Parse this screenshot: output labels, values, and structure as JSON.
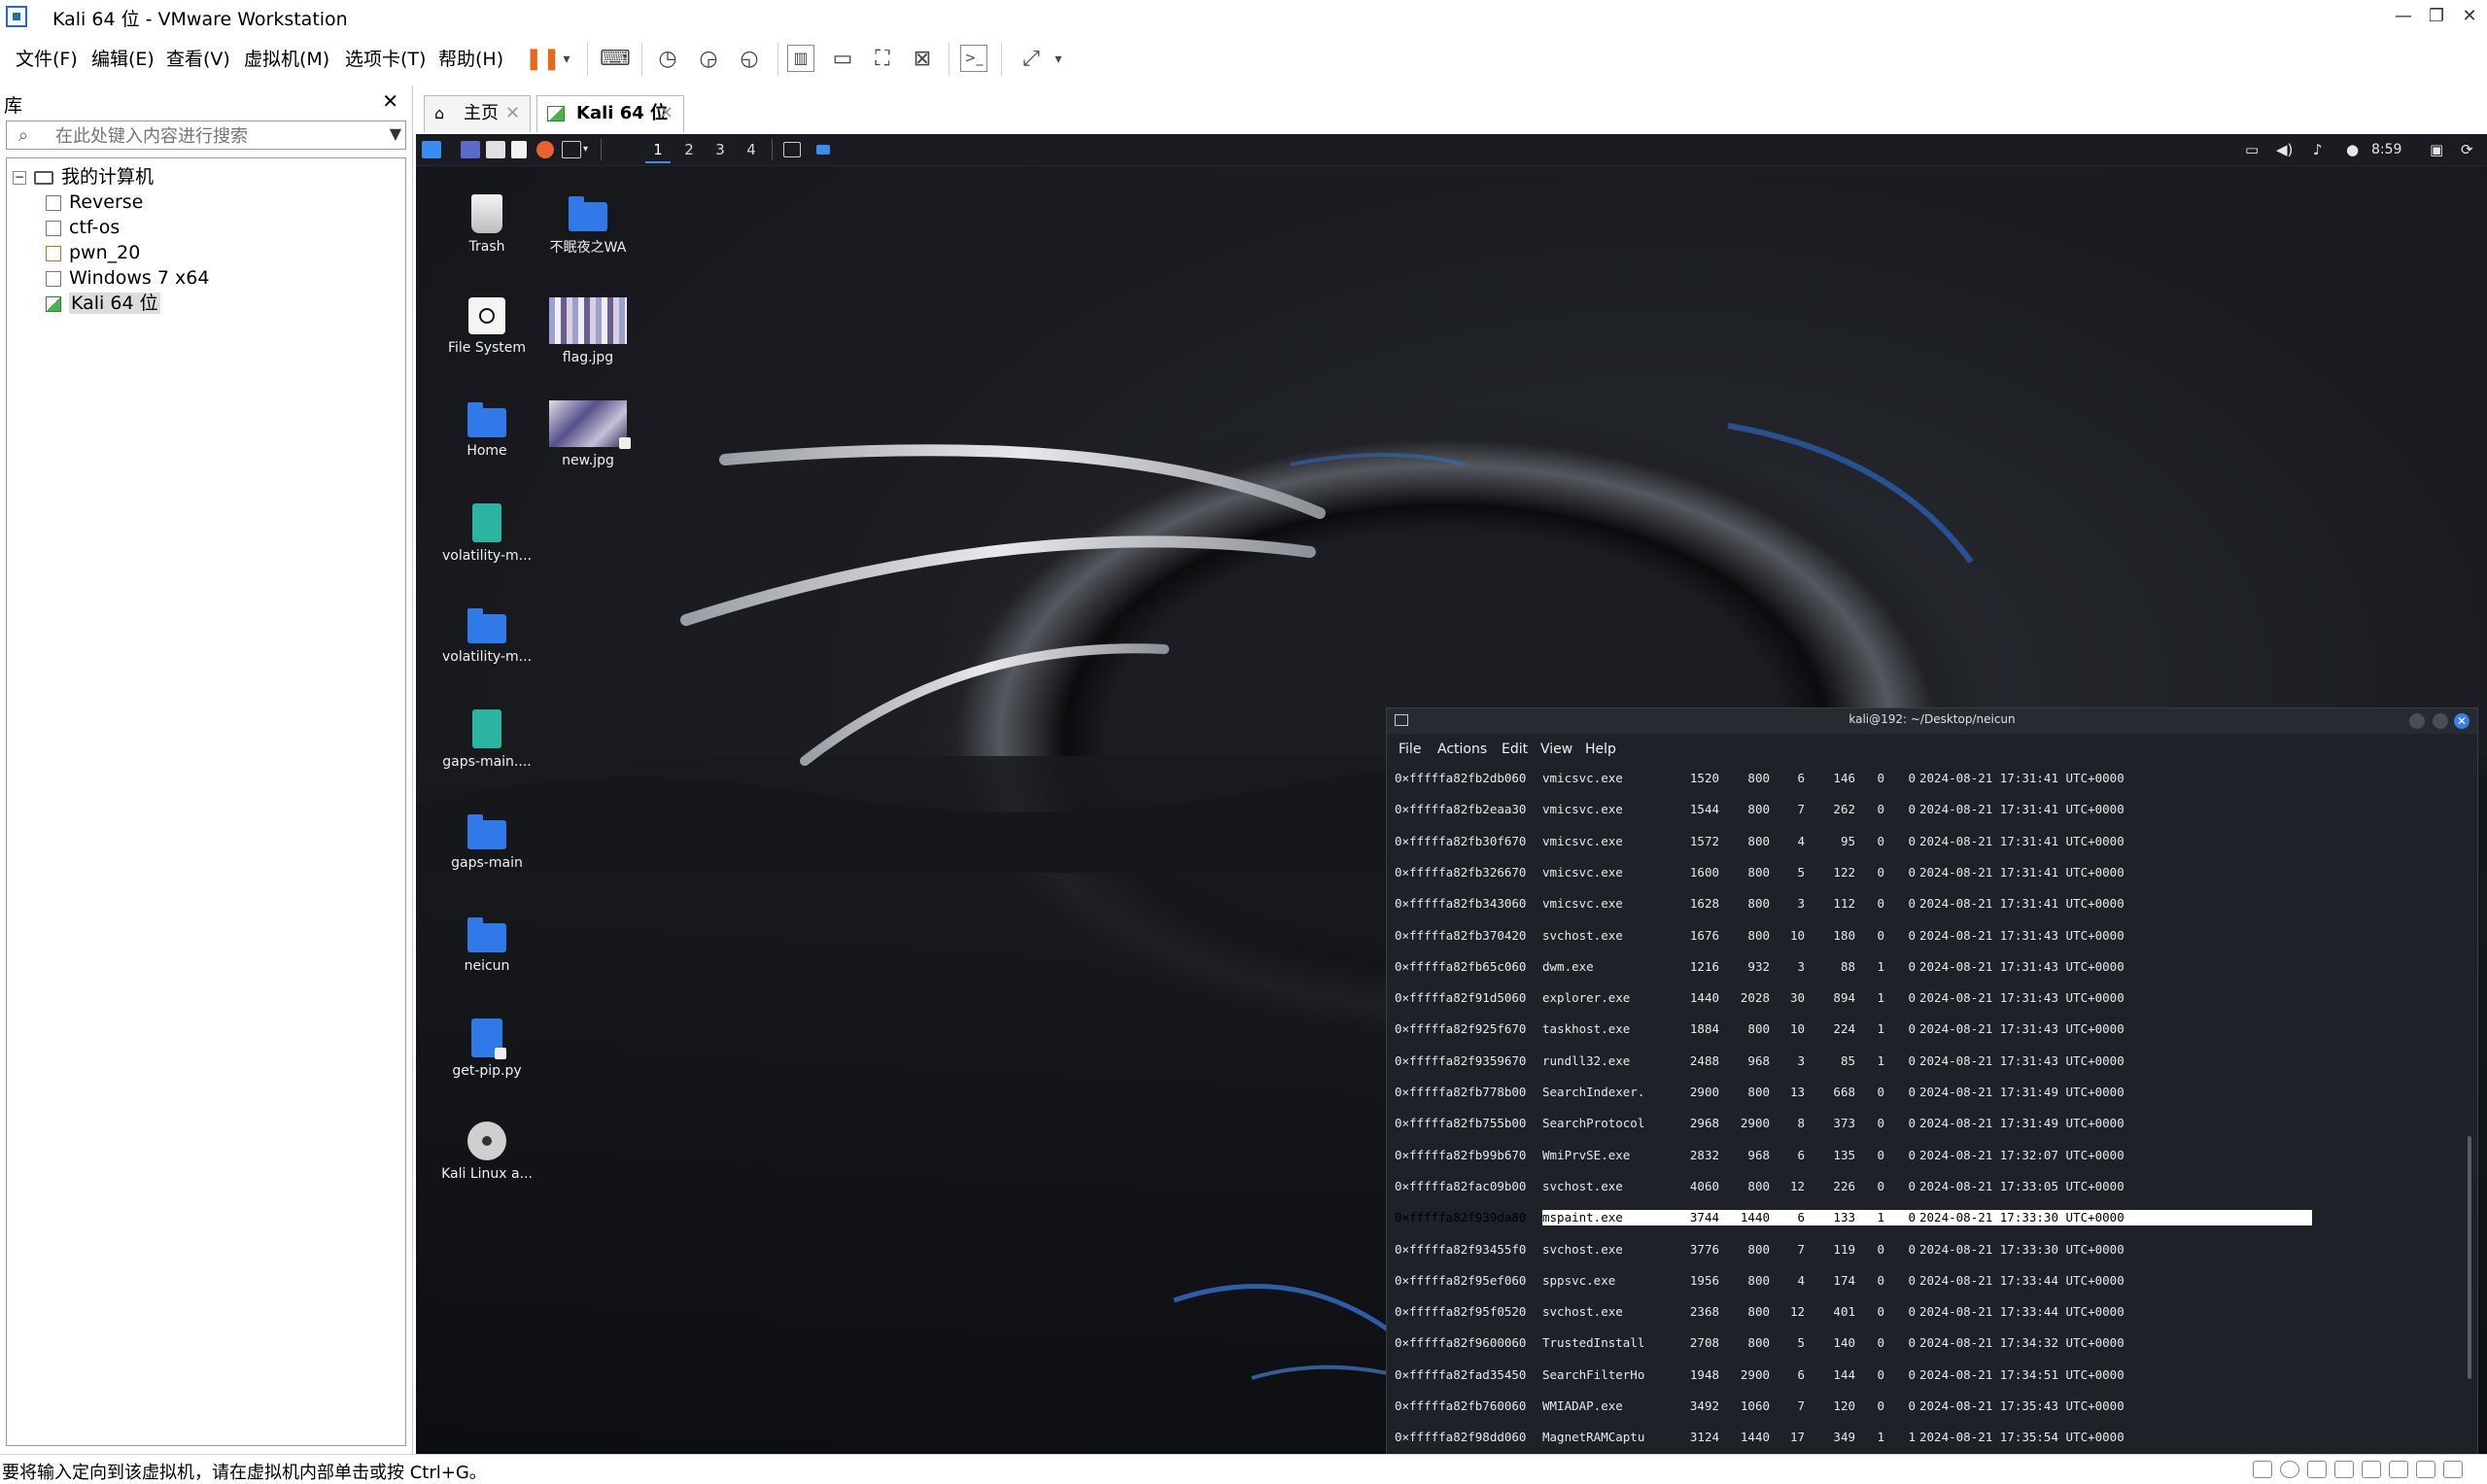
{
  "window": {
    "title": "Kali 64 位 - VMware Workstation",
    "app_icon": "vmware-icon",
    "controls": [
      "minimize",
      "restore",
      "close"
    ]
  },
  "menu": [
    "文件(F)",
    "编辑(E)",
    "查看(V)",
    "虚拟机(M)",
    "选项卡(T)",
    "帮助(H)"
  ],
  "toolbar": {
    "accent": "#e8681a",
    "icons": [
      "pause-icon",
      "dropdown-icon",
      "send-keys-icon",
      "snapshot-icon",
      "revert-snapshot-icon",
      "snapshot-manager-icon",
      "library-view-icon",
      "thumbnail-view-icon",
      "fullscreen-icon",
      "unity-icon",
      "console-icon",
      "stretch-icon",
      "dropdown-icon"
    ]
  },
  "library": {
    "title": "库",
    "search_placeholder": "在此处键入内容进行搜索",
    "root": "我的计算机",
    "items": [
      {
        "label": "Reverse",
        "icon": "vm-icon"
      },
      {
        "label": "ctf-os",
        "icon": "vm-icon"
      },
      {
        "label": "pwn_20",
        "icon": "vm-special-icon"
      },
      {
        "label": "Windows 7 x64",
        "icon": "vm-icon"
      },
      {
        "label": "Kali 64 位",
        "icon": "vm-running-icon",
        "selected": true
      }
    ]
  },
  "tabs": [
    {
      "label": "主页",
      "icon": "home-icon",
      "active": false
    },
    {
      "label": "Kali 64 位",
      "icon": "vm-running-icon",
      "active": true
    }
  ],
  "kali_panel": {
    "workspaces": [
      "1",
      "2",
      "3",
      "4"
    ],
    "active_workspace": "1",
    "clock": "8:59",
    "accent": "#3a8df0"
  },
  "desktop_icons": [
    {
      "label": "Trash",
      "icon": "trash-icon"
    },
    {
      "label": "不眠夜之WA",
      "icon": "folder-icon"
    },
    {
      "label": "File System",
      "icon": "filesystem-icon"
    },
    {
      "label": "flag.jpg",
      "icon": "image-icon"
    },
    {
      "label": "Home",
      "icon": "home-folder-icon"
    },
    {
      "label": "new.jpg",
      "icon": "image-icon"
    },
    {
      "label": "volatility-m...",
      "icon": "zip-icon"
    },
    {
      "label": "volatility-m...",
      "icon": "folder-icon"
    },
    {
      "label": "gaps-main....",
      "icon": "zip-icon"
    },
    {
      "label": "gaps-main",
      "icon": "folder-icon"
    },
    {
      "label": "neicun",
      "icon": "folder-icon"
    },
    {
      "label": "get-pip.py",
      "icon": "python-file-icon"
    },
    {
      "label": "Kali Linux a...",
      "icon": "disc-icon"
    }
  ],
  "terminal": {
    "title": "kali@192: ~/Desktop/neicun",
    "menu": [
      "File",
      "Actions",
      "Edit",
      "View",
      "Help"
    ],
    "rows": [
      {
        "offset": "0×fffffa82fb2db060",
        "name": "vmicsvc.exe",
        "pid": "1520",
        "ppid": "800",
        "thds": "6",
        "hnds": "146",
        "sess": "0",
        "wow64": "0",
        "start": "2024-08-21 17:31:41 UTC+0000"
      },
      {
        "offset": "0×fffffa82fb2eaa30",
        "name": "vmicsvc.exe",
        "pid": "1544",
        "ppid": "800",
        "thds": "7",
        "hnds": "262",
        "sess": "0",
        "wow64": "0",
        "start": "2024-08-21 17:31:41 UTC+0000"
      },
      {
        "offset": "0×fffffa82fb30f670",
        "name": "vmicsvc.exe",
        "pid": "1572",
        "ppid": "800",
        "thds": "4",
        "hnds": "95",
        "sess": "0",
        "wow64": "0",
        "start": "2024-08-21 17:31:41 UTC+0000"
      },
      {
        "offset": "0×fffffa82fb326670",
        "name": "vmicsvc.exe",
        "pid": "1600",
        "ppid": "800",
        "thds": "5",
        "hnds": "122",
        "sess": "0",
        "wow64": "0",
        "start": "2024-08-21 17:31:41 UTC+0000"
      },
      {
        "offset": "0×fffffa82fb343060",
        "name": "vmicsvc.exe",
        "pid": "1628",
        "ppid": "800",
        "thds": "3",
        "hnds": "112",
        "sess": "0",
        "wow64": "0",
        "start": "2024-08-21 17:31:41 UTC+0000"
      },
      {
        "offset": "0×fffffa82fb370420",
        "name": "svchost.exe",
        "pid": "1676",
        "ppid": "800",
        "thds": "10",
        "hnds": "180",
        "sess": "0",
        "wow64": "0",
        "start": "2024-08-21 17:31:43 UTC+0000"
      },
      {
        "offset": "0×fffffa82fb65c060",
        "name": "dwm.exe",
        "pid": "1216",
        "ppid": "932",
        "thds": "3",
        "hnds": "88",
        "sess": "1",
        "wow64": "0",
        "start": "2024-08-21 17:31:43 UTC+0000"
      },
      {
        "offset": "0×fffffa82f91d5060",
        "name": "explorer.exe",
        "pid": "1440",
        "ppid": "2028",
        "thds": "30",
        "hnds": "894",
        "sess": "1",
        "wow64": "0",
        "start": "2024-08-21 17:31:43 UTC+0000"
      },
      {
        "offset": "0×fffffa82f925f670",
        "name": "taskhost.exe",
        "pid": "1884",
        "ppid": "800",
        "thds": "10",
        "hnds": "224",
        "sess": "1",
        "wow64": "0",
        "start": "2024-08-21 17:31:43 UTC+0000"
      },
      {
        "offset": "0×fffffa82f9359670",
        "name": "rundll32.exe",
        "pid": "2488",
        "ppid": "968",
        "thds": "3",
        "hnds": "85",
        "sess": "1",
        "wow64": "0",
        "start": "2024-08-21 17:31:43 UTC+0000"
      },
      {
        "offset": "0×fffffa82fb778b00",
        "name": "SearchIndexer.",
        "pid": "2900",
        "ppid": "800",
        "thds": "13",
        "hnds": "668",
        "sess": "0",
        "wow64": "0",
        "start": "2024-08-21 17:31:49 UTC+0000"
      },
      {
        "offset": "0×fffffa82fb755b00",
        "name": "SearchProtocol",
        "pid": "2968",
        "ppid": "2900",
        "thds": "8",
        "hnds": "373",
        "sess": "0",
        "wow64": "0",
        "start": "2024-08-21 17:31:49 UTC+0000"
      },
      {
        "offset": "0×fffffa82fb99b670",
        "name": "WmiPrvSE.exe",
        "pid": "2832",
        "ppid": "968",
        "thds": "6",
        "hnds": "135",
        "sess": "0",
        "wow64": "0",
        "start": "2024-08-21 17:32:07 UTC+0000"
      },
      {
        "offset": "0×fffffa82fac09b00",
        "name": "svchost.exe",
        "pid": "4060",
        "ppid": "800",
        "thds": "12",
        "hnds": "226",
        "sess": "0",
        "wow64": "0",
        "start": "2024-08-21 17:33:05 UTC+0000"
      },
      {
        "offset": "0×fffffa82f939da80",
        "name": "mspaint.exe",
        "pid": "3744",
        "ppid": "1440",
        "thds": "6",
        "hnds": "133",
        "sess": "1",
        "wow64": "0",
        "start": "2024-08-21 17:33:30 UTC+0000",
        "highlighted": true
      },
      {
        "offset": "0×fffffa82f93455f0",
        "name": "svchost.exe",
        "pid": "3776",
        "ppid": "800",
        "thds": "7",
        "hnds": "119",
        "sess": "0",
        "wow64": "0",
        "start": "2024-08-21 17:33:30 UTC+0000"
      },
      {
        "offset": "0×fffffa82f95ef060",
        "name": "sppsvc.exe",
        "pid": "1956",
        "ppid": "800",
        "thds": "4",
        "hnds": "174",
        "sess": "0",
        "wow64": "0",
        "start": "2024-08-21 17:33:44 UTC+0000"
      },
      {
        "offset": "0×fffffa82f95f0520",
        "name": "svchost.exe",
        "pid": "2368",
        "ppid": "800",
        "thds": "12",
        "hnds": "401",
        "sess": "0",
        "wow64": "0",
        "start": "2024-08-21 17:33:44 UTC+0000"
      },
      {
        "offset": "0×fffffa82f9600060",
        "name": "TrustedInstall",
        "pid": "2708",
        "ppid": "800",
        "thds": "5",
        "hnds": "140",
        "sess": "0",
        "wow64": "0",
        "start": "2024-08-21 17:34:32 UTC+0000"
      },
      {
        "offset": "0×fffffa82fad35450",
        "name": "SearchFilterHo",
        "pid": "1948",
        "ppid": "2900",
        "thds": "6",
        "hnds": "144",
        "sess": "0",
        "wow64": "0",
        "start": "2024-08-21 17:34:51 UTC+0000"
      },
      {
        "offset": "0×fffffa82fb760060",
        "name": "WMIADAP.exe",
        "pid": "3492",
        "ppid": "1060",
        "thds": "7",
        "hnds": "120",
        "sess": "0",
        "wow64": "0",
        "start": "2024-08-21 17:35:43 UTC+0000"
      },
      {
        "offset": "0×fffffa82f98dd060",
        "name": "MagnetRAMCaptu",
        "pid": "3124",
        "ppid": "1440",
        "thds": "17",
        "hnds": "349",
        "sess": "1",
        "wow64": "1",
        "start": "2024-08-21 17:35:54 UTC+0000"
      }
    ]
  },
  "status": {
    "message": "要将输入定向到该虚拟机，请在虚拟机内部单击或按 Ctrl+G。",
    "icons": [
      "hdd-icon",
      "cd-icon",
      "network-icon",
      "usb-icon",
      "sound-icon",
      "printer-icon",
      "display-icon",
      "message-icon"
    ]
  }
}
